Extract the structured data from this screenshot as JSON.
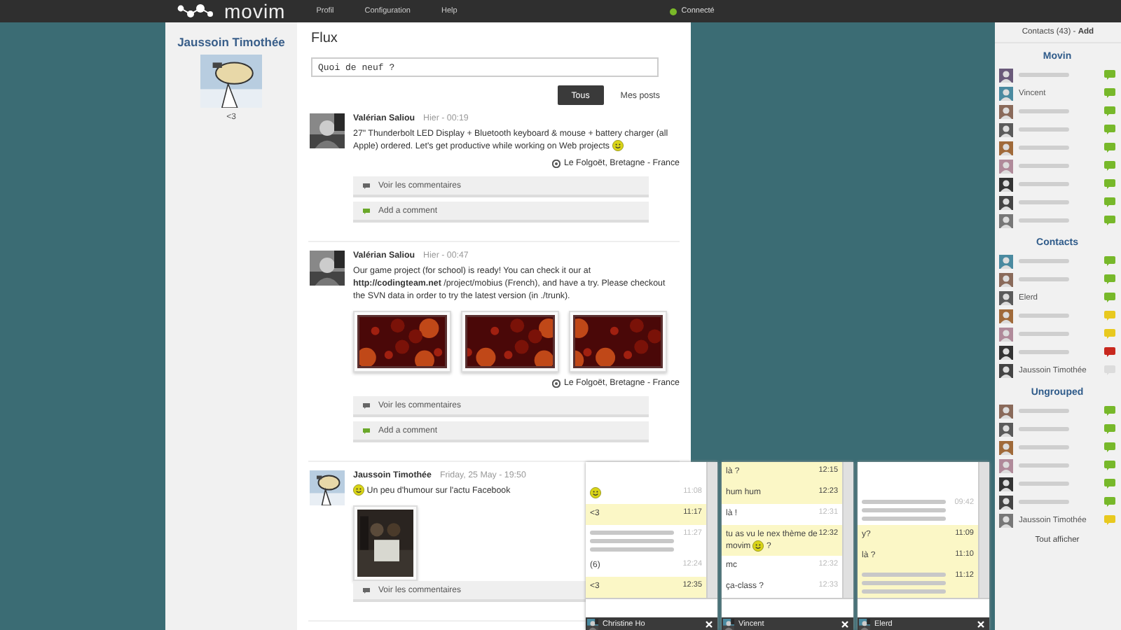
{
  "topbar": {
    "logo": "movim",
    "menu": [
      {
        "label": "Profil"
      },
      {
        "label": "Configuration"
      },
      {
        "label": "Help"
      }
    ],
    "status": {
      "label": "Connecté",
      "color": "#7ab929"
    }
  },
  "profile": {
    "name": "Jaussoin Timothée",
    "mood": "<3"
  },
  "feed": {
    "title": "Flux",
    "composer": {
      "placeholder": "Quoi de neuf ?"
    },
    "filters": [
      {
        "label": "Tous",
        "selected": true
      },
      {
        "label": "Mes posts",
        "selected": false
      }
    ],
    "posts": [
      {
        "author": "Valérian Saliou",
        "date": "Hier - 00:19",
        "text": "27\" Thunderbolt LED Display + Bluetooth keyboard & mouse + battery charger (all Apple) ordered. Let's get productive while working on Web projects",
        "emoji_end": true,
        "location": "Le Folgoët, Bretagne - France",
        "actions": [
          {
            "kind": "comments",
            "label": "Voir les commentaires"
          },
          {
            "kind": "add",
            "label": "Add a comment"
          }
        ]
      },
      {
        "author": "Valérian Saliou",
        "date": "Hier - 00:47",
        "text": "Our game project (for school) is ready! You can check it our at **http://codingteam.net** /project/mobius (French), and have a try. Please checkout the SVN data in order to try the latest version (in ./trunk).",
        "pictures": [
          {
            "kind": "picture"
          },
          {
            "kind": "picture"
          },
          {
            "kind": "picture"
          }
        ],
        "location": "Le Folgoët, Bretagne - France",
        "actions": [
          {
            "kind": "comments",
            "label": "Voir les commentaires"
          },
          {
            "kind": "add",
            "label": "Add a comment"
          }
        ]
      },
      {
        "author": "Jaussoin Timothée",
        "date": "Friday, 25 May - 19:50",
        "text": "Un peu d'humour sur l'actu Facebook",
        "emoji_start": true,
        "pictures": [
          {
            "kind": "picture"
          }
        ],
        "actions": [
          {
            "kind": "comments",
            "label": "Voir les commentaires"
          }
        ]
      }
    ]
  },
  "contacts": {
    "title": "Contacts (43) - **Add**",
    "groups": [
      {
        "name": "Movin",
        "contacts": [
          {
            "kind": "blurred",
            "color": "#77b82a"
          },
          {
            "kind": "named",
            "name": "Vincent",
            "color": "#77b82a"
          },
          {
            "kind": "blurred",
            "color": "#77b82a"
          },
          {
            "kind": "blurred",
            "color": "#77b82a"
          },
          {
            "kind": "blurred",
            "color": "#77b82a"
          },
          {
            "kind": "blurred",
            "color": "#77b82a"
          },
          {
            "kind": "blurred",
            "color": "#77b82a"
          },
          {
            "kind": "blurred",
            "color": "#77b82a"
          },
          {
            "kind": "blurred",
            "color": "#77b82a"
          }
        ]
      },
      {
        "name": "Contacts",
        "contacts": [
          {
            "kind": "blurred",
            "color": "#77b82a"
          },
          {
            "kind": "blurred",
            "color": "#77b82a"
          },
          {
            "kind": "named",
            "name": "Elerd",
            "color": "#77b82a"
          },
          {
            "kind": "blurred",
            "color": "#e8c91f"
          },
          {
            "kind": "blurred",
            "color": "#e8c91f"
          },
          {
            "kind": "blurred",
            "color": "#c8281e"
          },
          {
            "kind": "named",
            "name": "Jaussoin Timothée",
            "color": "#dcdcdc"
          }
        ]
      },
      {
        "name": "Ungrouped",
        "contacts": [
          {
            "kind": "blurred",
            "color": "#77b82a"
          },
          {
            "kind": "blurred",
            "color": "#77b82a"
          },
          {
            "kind": "blurred",
            "color": "#77b82a"
          },
          {
            "kind": "blurred",
            "color": "#77b82a"
          },
          {
            "kind": "blurred",
            "color": "#77b82a"
          },
          {
            "kind": "blurred",
            "color": "#77b82a"
          },
          {
            "kind": "named",
            "name": "Jaussoin Timothée",
            "color": "#e8c91f"
          }
        ]
      }
    ],
    "show_all": "Tout afficher"
  },
  "chats": [
    {
      "name": "Christine Ho",
      "messages": [
        {
          "kind": "emoji",
          "mine": false,
          "time": "11:08"
        },
        {
          "kind": "text",
          "mine": true,
          "text": "<3",
          "time": "11:17"
        },
        {
          "kind": "blurred",
          "mine": false,
          "time": "11:27"
        },
        {
          "kind": "text",
          "mine": false,
          "text": "(6)",
          "time": "12:24"
        },
        {
          "kind": "text",
          "mine": true,
          "text": "<3",
          "time": "12:35"
        }
      ]
    },
    {
      "name": "Vincent",
      "messages": [
        {
          "kind": "text",
          "mine": true,
          "text": "là ?",
          "time": "12:15"
        },
        {
          "kind": "text",
          "mine": true,
          "text": "hum hum",
          "time": "12:23"
        },
        {
          "kind": "text",
          "mine": false,
          "text": "là !",
          "time": "12:31"
        },
        {
          "kind": "emoji_text",
          "mine": true,
          "text": "tu as vu le nex thème de movim",
          "tail": "?",
          "time": "12:32"
        },
        {
          "kind": "text",
          "mine": false,
          "text": "mc",
          "time": "12:32"
        },
        {
          "kind": "text",
          "mine": false,
          "text": "ça-class ?",
          "time": "12:33"
        }
      ]
    },
    {
      "name": "Elerd",
      "messages": [
        {
          "kind": "blurred",
          "mine": false,
          "time": "09:42"
        },
        {
          "kind": "text",
          "mine": true,
          "text": "y?",
          "time": "11:09"
        },
        {
          "kind": "text",
          "mine": true,
          "text": "là ?",
          "time": "11:10"
        },
        {
          "kind": "blurred",
          "mine": true,
          "time": "11:12"
        }
      ]
    }
  ]
}
